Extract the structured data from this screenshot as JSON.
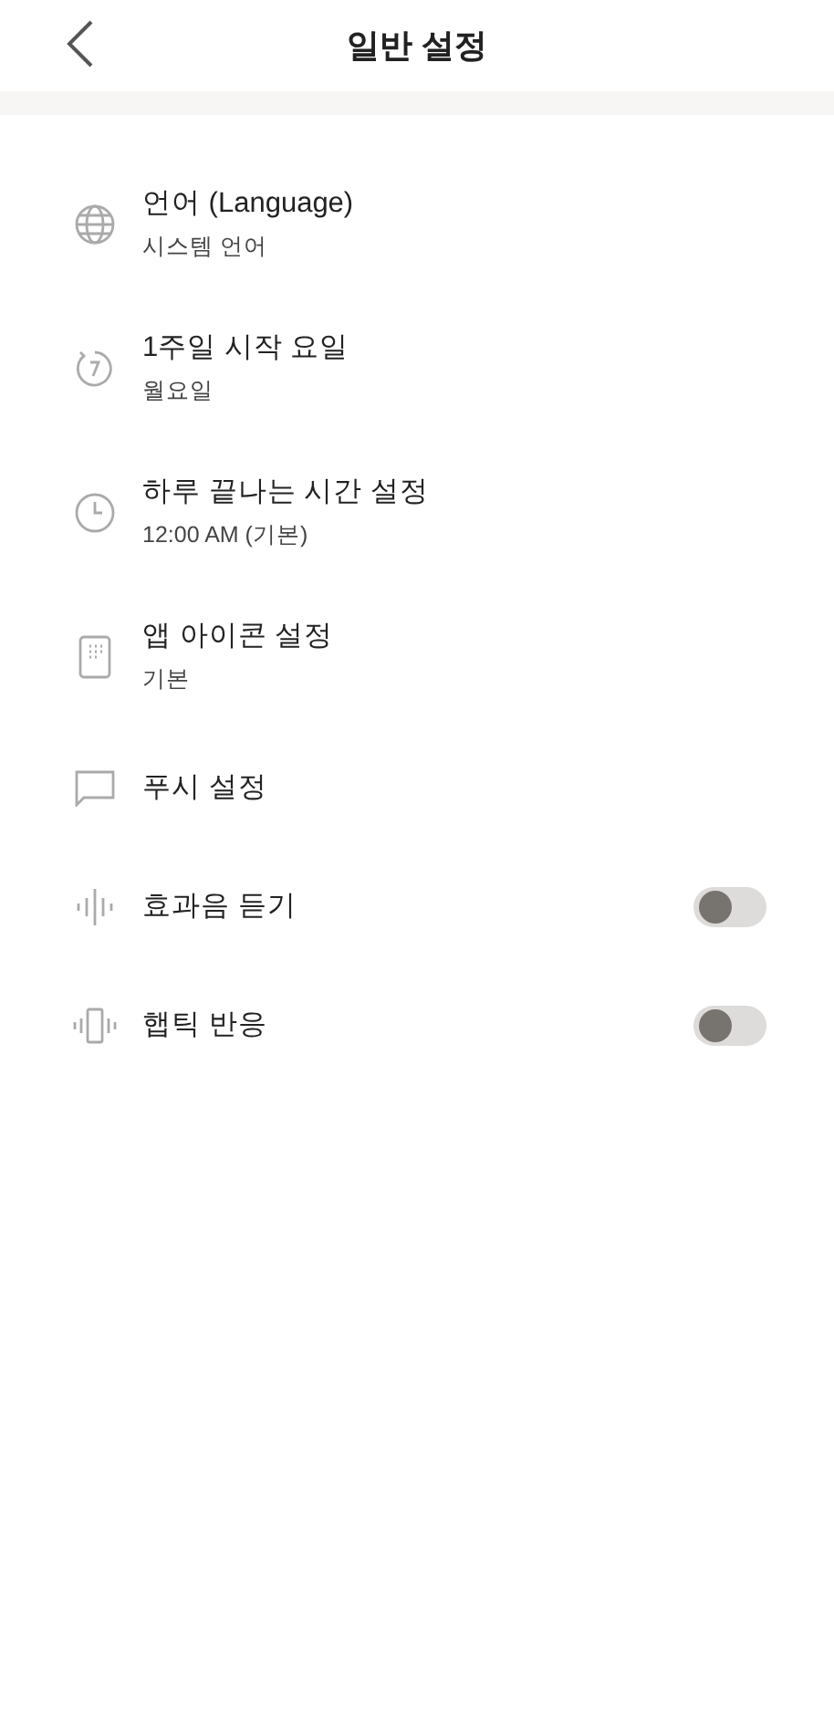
{
  "header": {
    "title": "일반 설정"
  },
  "items": [
    {
      "kind": "link",
      "title": "언어 (Language)",
      "subtitle": "시스템 언어"
    },
    {
      "kind": "link",
      "title": "1주일 시작 요일",
      "subtitle": "월요일"
    },
    {
      "kind": "link",
      "title": "하루 끝나는 시간 설정",
      "subtitle": "12:00 AM (기본)"
    },
    {
      "kind": "link",
      "title": "앱 아이콘 설정",
      "subtitle": "기본"
    },
    {
      "kind": "link",
      "title": "푸시 설정"
    },
    {
      "kind": "toggle",
      "title": "효과음 듣기",
      "on": false
    },
    {
      "kind": "toggle",
      "title": "햅틱 반응",
      "on": false
    }
  ]
}
